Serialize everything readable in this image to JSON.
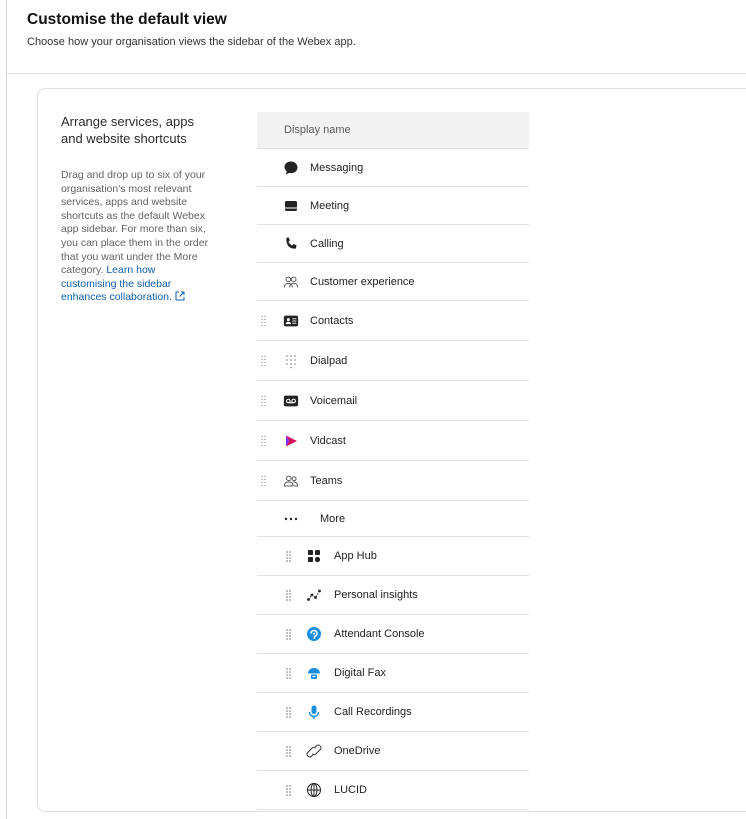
{
  "header": {
    "title": "Customise the default view",
    "subtitle": "Choose how your organisation views the sidebar of the Webex app."
  },
  "side": {
    "title": "Arrange services, apps and website shortcuts",
    "description": "Drag and drop up to six of your organisation's most relevant services, apps and website shortcuts as the default Webex app sidebar. For more than six, you can place them in the order that you want under the More category.",
    "link": "Learn how customising the sidebar enhances collaboration."
  },
  "table": {
    "header": "Display name",
    "items": [
      {
        "label": "Messaging",
        "icon": "message-bubble-icon",
        "draggable": false
      },
      {
        "label": "Meeting",
        "icon": "meeting-icon",
        "draggable": false
      },
      {
        "label": "Calling",
        "icon": "phone-icon",
        "draggable": false
      },
      {
        "label": "Customer experience",
        "icon": "people-headset-icon",
        "draggable": false
      },
      {
        "label": "Contacts",
        "icon": "contact-card-icon",
        "draggable": true
      },
      {
        "label": "Dialpad",
        "icon": "dialpad-icon",
        "draggable": true
      },
      {
        "label": "Voicemail",
        "icon": "voicemail-icon",
        "draggable": true
      },
      {
        "label": "Vidcast",
        "icon": "vidcast-icon",
        "draggable": true
      },
      {
        "label": "Teams",
        "icon": "teams-icon",
        "draggable": true
      }
    ],
    "more_label": "More",
    "more_items": [
      {
        "label": "App Hub",
        "icon": "app-hub-icon"
      },
      {
        "label": "Personal insights",
        "icon": "insights-icon"
      },
      {
        "label": "Attendant Console",
        "icon": "attendant-console-icon"
      },
      {
        "label": "Digital Fax",
        "icon": "digital-fax-icon"
      },
      {
        "label": "Call Recordings",
        "icon": "call-recordings-icon"
      },
      {
        "label": "OneDrive",
        "icon": "onedrive-link-icon"
      },
      {
        "label": "LUCID",
        "icon": "globe-icon"
      }
    ]
  },
  "colors": {
    "link": "#0f5ea8",
    "vidcast": "#d4145a",
    "app_blue": "#1a8fe0"
  }
}
